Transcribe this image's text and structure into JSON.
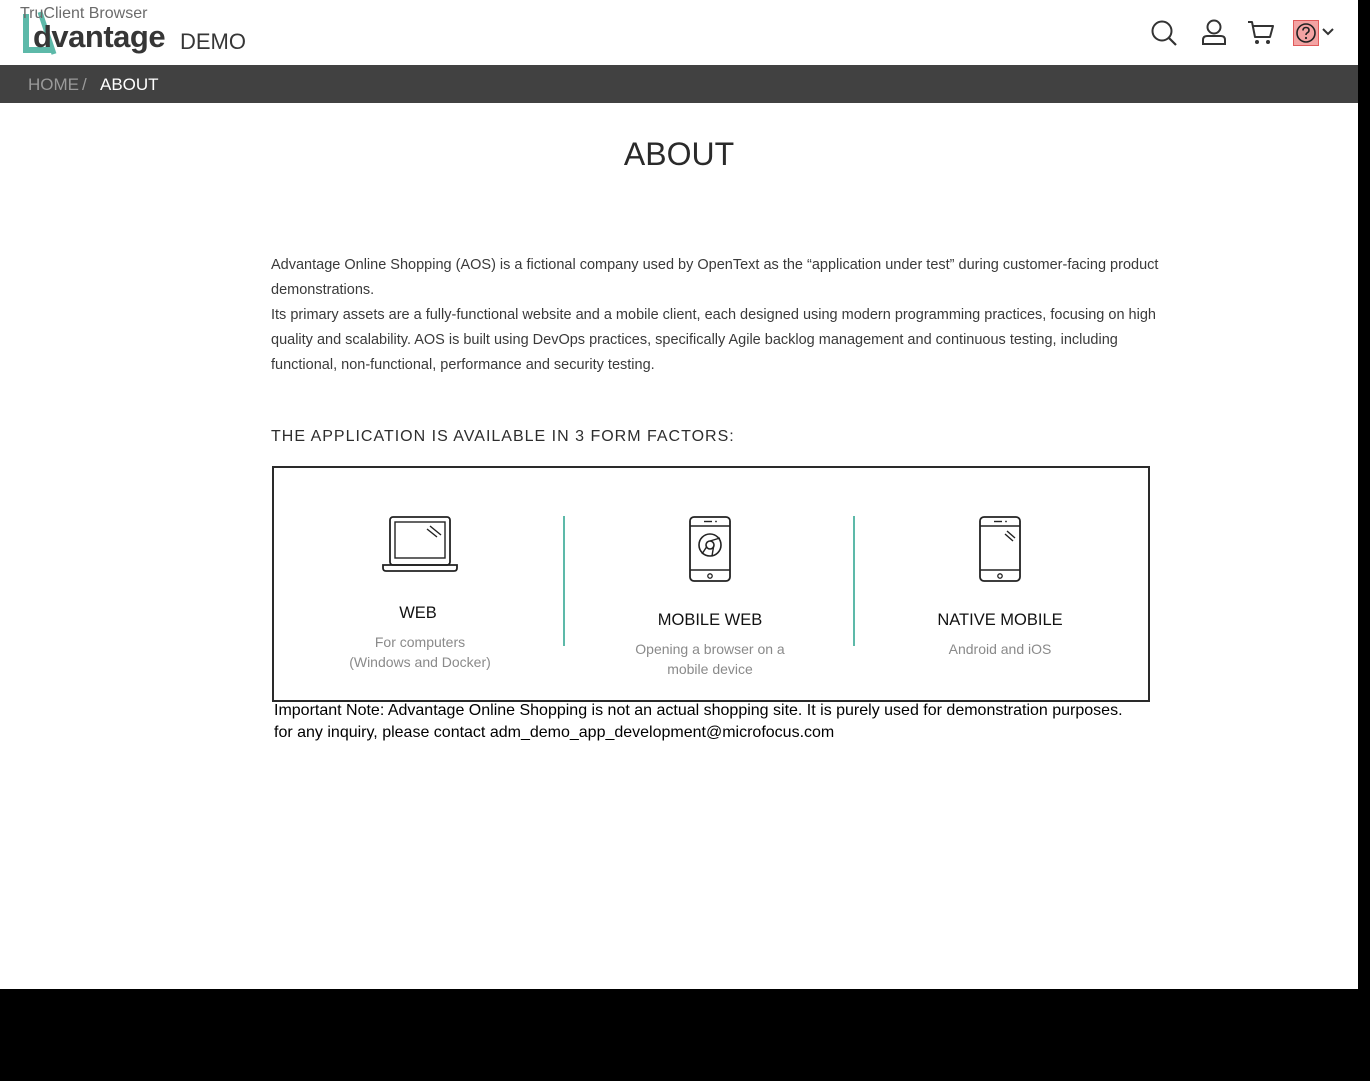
{
  "browser": {
    "label": "TruClient Browser"
  },
  "header": {
    "logo_text": "dvantage",
    "logo_suffix": "DEMO",
    "icons": [
      "search-icon",
      "user-icon",
      "cart-icon",
      "help-icon",
      "chevron-down-icon"
    ],
    "accent_color": "#5db9a9"
  },
  "breadcrumb": {
    "home": "HOME",
    "separator": "/",
    "current": "ABOUT"
  },
  "page": {
    "title": "ABOUT",
    "intro_1": "Advantage Online Shopping (AOS) is a fictional company used by OpenText as the “application under test” during customer-facing product demonstrations.",
    "intro_2": "Its primary assets are a fully-functional website and a mobile client, each designed using modern programming practices, focusing on high quality and scalability.  AOS is built using DevOps practices, specifically Agile backlog management and continuous testing, including functional, non-functional, performance and security testing.",
    "section_heading": "THE APPLICATION IS AVAILABLE IN 3 FORM FACTORS:"
  },
  "form_factors": [
    {
      "title": "WEB",
      "desc_1": "For computers",
      "desc_2": "(Windows and Docker)",
      "icon": "laptop-icon"
    },
    {
      "title": "MOBILE WEB",
      "desc_1": "Opening a browser on a",
      "desc_2": "mobile device",
      "icon": "mobile-browser-icon"
    },
    {
      "title": "NATIVE MOBILE",
      "desc_1": "Android and iOS",
      "icon": "smartphone-icon"
    }
  ],
  "note": {
    "line_1": "Important Note: Advantage Online Shopping is not an actual shopping site.  It is purely used for demonstration purposes.",
    "line_2": "for any inquiry, please contact adm_demo_app_development@microfocus.com"
  }
}
